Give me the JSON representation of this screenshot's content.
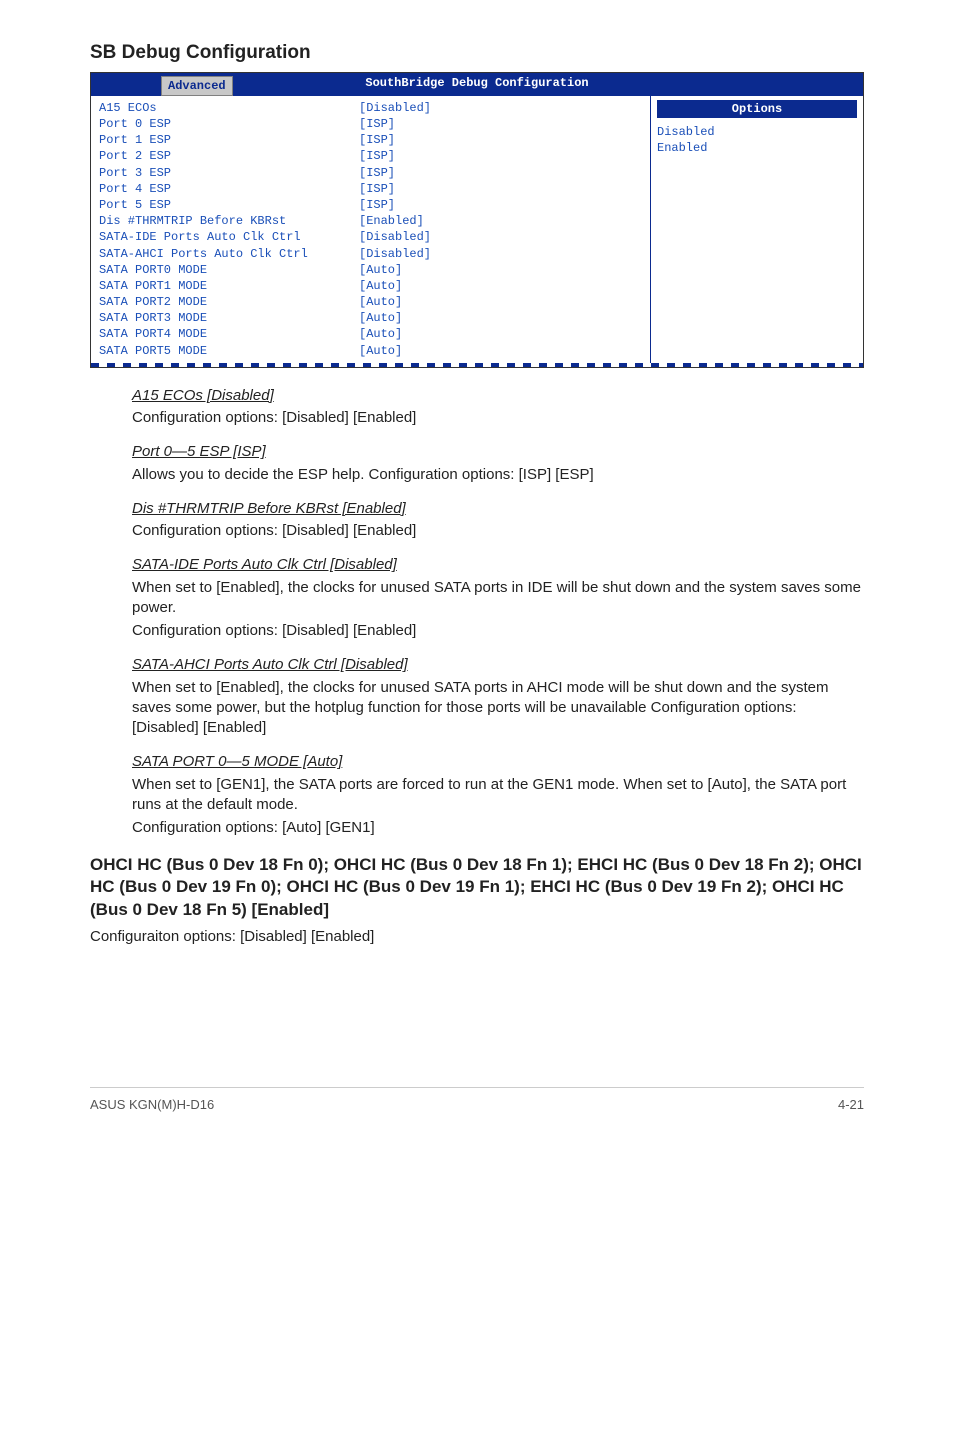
{
  "heading": "SB Debug Configuration",
  "bios": {
    "title": "SouthBridge Debug Configuration",
    "tab": "Advanced",
    "options_header": "Options",
    "side_options": [
      "Disabled",
      "Enabled"
    ],
    "rows": [
      {
        "label": "A15 ECOs",
        "value": "[Disabled]"
      },
      {
        "label": "Port 0 ESP",
        "value": "[ISP]"
      },
      {
        "label": "Port 1 ESP",
        "value": "[ISP]"
      },
      {
        "label": "Port 2 ESP",
        "value": "[ISP]"
      },
      {
        "label": "Port 3 ESP",
        "value": "[ISP]"
      },
      {
        "label": "Port 4 ESP",
        "value": "[ISP]"
      },
      {
        "label": "Port 5 ESP",
        "value": "[ISP]"
      },
      {
        "label": "Dis #THRMTRIP Before KBRst",
        "value": "[Enabled]"
      },
      {
        "label": "SATA-IDE Ports Auto Clk Ctrl",
        "value": "[Disabled]"
      },
      {
        "label": "SATA-AHCI Ports Auto Clk Ctrl",
        "value": "[Disabled]"
      },
      {
        "label": "SATA PORT0 MODE",
        "value": "[Auto]"
      },
      {
        "label": "SATA PORT1 MODE",
        "value": "[Auto]"
      },
      {
        "label": "SATA PORT2 MODE",
        "value": "[Auto]"
      },
      {
        "label": "SATA PORT3 MODE",
        "value": "[Auto]"
      },
      {
        "label": "SATA PORT4 MODE",
        "value": "[Auto]"
      },
      {
        "label": "SATA PORT5 MODE",
        "value": "[Auto]"
      }
    ]
  },
  "sections": [
    {
      "title": "A15 ECOs [Disabled]",
      "body": [
        "Configuration options: [Disabled] [Enabled]"
      ]
    },
    {
      "title": "Port 0—5 ESP [ISP]",
      "body": [
        "Allows you to decide the ESP help. Configuration options: [ISP] [ESP]"
      ]
    },
    {
      "title": "Dis #THRMTRIP Before KBRst [Enabled]",
      "body": [
        "Configuration options: [Disabled] [Enabled]"
      ]
    },
    {
      "title": "SATA-IDE Ports Auto Clk Ctrl [Disabled]",
      "body": [
        "When set to [Enabled], the clocks for unused SATA ports in IDE will be shut down and the system saves some power.",
        "Configuration options: [Disabled] [Enabled]"
      ]
    },
    {
      "title": "SATA-AHCI Ports Auto Clk Ctrl [Disabled]",
      "body": [
        "When set to [Enabled], the clocks for unused SATA ports in AHCI mode will be shut down and the system saves some power, but the hotplug function for those ports will be unavailable Configuration options: [Disabled] [Enabled]"
      ]
    },
    {
      "title": "SATA PORT 0—5 MODE [Auto]",
      "body": [
        "When set to [GEN1], the SATA ports are forced to run at the GEN1 mode. When set to [Auto], the SATA port runs at the default mode.",
        "Configuration options: [Auto] [GEN1]"
      ]
    }
  ],
  "big_heading": "OHCI HC (Bus 0 Dev 18 Fn 0); OHCI HC (Bus 0 Dev 18 Fn 1); EHCI HC (Bus 0 Dev 18 Fn 2); OHCI HC (Bus 0 Dev 19 Fn 0); OHCI HC (Bus 0 Dev 19 Fn 1); EHCI HC (Bus 0 Dev 19 Fn 2); OHCI HC (Bus 0 Dev 18 Fn 5) [Enabled]",
  "big_heading_body": "Configuraiton options: [Disabled] [Enabled]",
  "footer_left": "ASUS KGN(M)H-D16",
  "footer_right": "4-21"
}
